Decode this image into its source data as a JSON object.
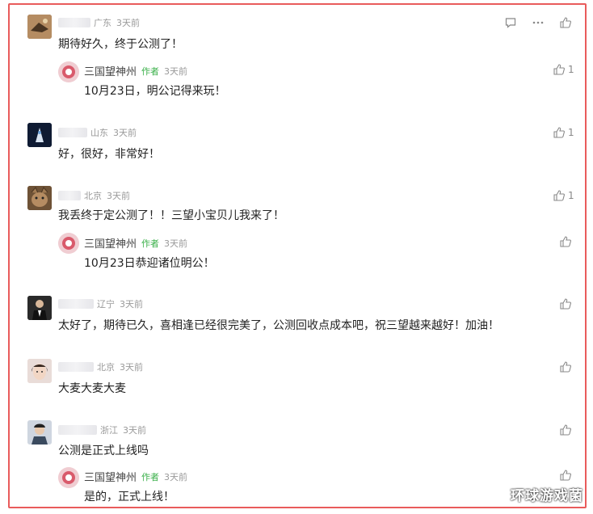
{
  "comments": [
    {
      "location": "广东",
      "time": "3天前",
      "text": "期待好久，终于公测了！",
      "likes": "",
      "reply": {
        "name": "三国望神州",
        "tag": "作者",
        "time": "3天前",
        "text": "10月23日，明公记得来玩！",
        "likes": "1"
      }
    },
    {
      "location": "山东",
      "time": "3天前",
      "text": "好，很好，非常好！",
      "likes": "1"
    },
    {
      "location": "北京",
      "time": "3天前",
      "text": "我丢终于定公测了！！三望小宝贝儿我来了！",
      "likes": "1",
      "reply": {
        "name": "三国望神州",
        "tag": "作者",
        "time": "3天前",
        "text": "10月23日恭迎诸位明公！",
        "likes": ""
      }
    },
    {
      "location": "辽宁",
      "time": "3天前",
      "text": "太好了，期待已久，喜相逢已经很完美了，公测回收点成本吧，祝三望越来越好！加油！",
      "likes": ""
    },
    {
      "location": "北京",
      "time": "3天前",
      "text": "大麦大麦大麦",
      "likes": ""
    },
    {
      "location": "浙江",
      "time": "3天前",
      "text": "公测是正式上线吗",
      "likes": "",
      "reply": {
        "name": "三国望神州",
        "tag": "作者",
        "time": "3天前",
        "text": "是的，正式上线！",
        "likes": ""
      }
    }
  ],
  "watermark": "环球游戏菌",
  "colors": {
    "frame": "#e95b5b",
    "author_tag": "#3bb04a"
  }
}
